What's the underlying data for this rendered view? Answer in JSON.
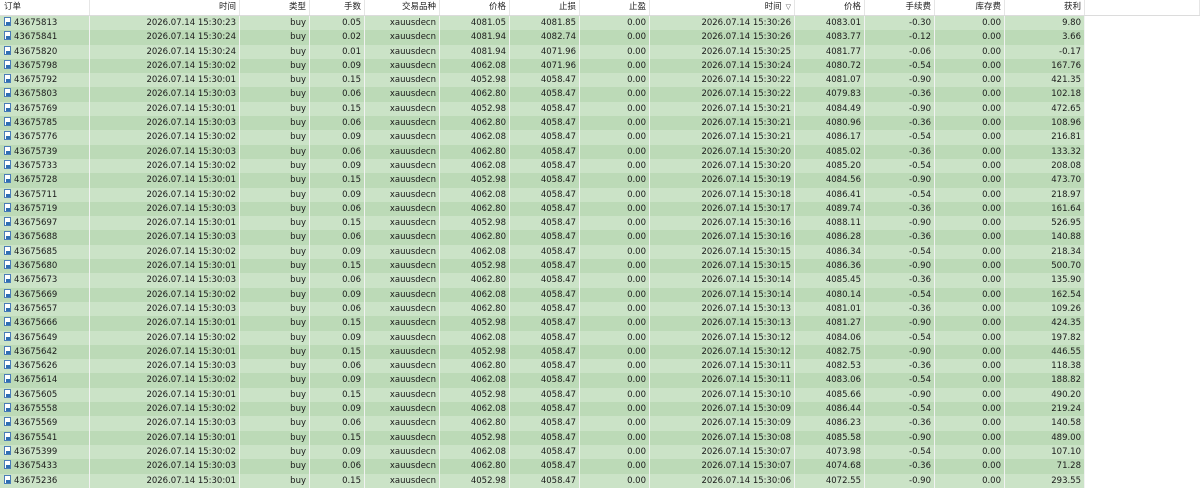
{
  "columns": {
    "order": "订单",
    "open_time": "时间",
    "type": "类型",
    "lots": "手数",
    "symbol": "交易品种",
    "open_price": "价格",
    "sl": "止损",
    "tp": "止盈",
    "close_time": "时间",
    "close_price": "价格",
    "commission": "手续费",
    "swap": "库存费",
    "profit": "获利"
  },
  "sort_indicator": "▽",
  "rows": [
    {
      "order": "43675813",
      "open_time": "2026.07.14 15:30:23",
      "type": "buy",
      "lots": "0.05",
      "symbol": "xauusdecn",
      "open_price": "4081.05",
      "sl": "4081.85",
      "tp": "0.00",
      "close_time": "2026.07.14 15:30:26",
      "close_price": "4083.01",
      "commission": "-0.30",
      "swap": "0.00",
      "profit": "9.80"
    },
    {
      "order": "43675841",
      "open_time": "2026.07.14 15:30:24",
      "type": "buy",
      "lots": "0.02",
      "symbol": "xauusdecn",
      "open_price": "4081.94",
      "sl": "4082.74",
      "tp": "0.00",
      "close_time": "2026.07.14 15:30:26",
      "close_price": "4083.77",
      "commission": "-0.12",
      "swap": "0.00",
      "profit": "3.66"
    },
    {
      "order": "43675820",
      "open_time": "2026.07.14 15:30:24",
      "type": "buy",
      "lots": "0.01",
      "symbol": "xauusdecn",
      "open_price": "4081.94",
      "sl": "4071.96",
      "tp": "0.00",
      "close_time": "2026.07.14 15:30:25",
      "close_price": "4081.77",
      "commission": "-0.06",
      "swap": "0.00",
      "profit": "-0.17"
    },
    {
      "order": "43675798",
      "open_time": "2026.07.14 15:30:02",
      "type": "buy",
      "lots": "0.09",
      "symbol": "xauusdecn",
      "open_price": "4062.08",
      "sl": "4071.96",
      "tp": "0.00",
      "close_time": "2026.07.14 15:30:24",
      "close_price": "4080.72",
      "commission": "-0.54",
      "swap": "0.00",
      "profit": "167.76"
    },
    {
      "order": "43675792",
      "open_time": "2026.07.14 15:30:01",
      "type": "buy",
      "lots": "0.15",
      "symbol": "xauusdecn",
      "open_price": "4052.98",
      "sl": "4058.47",
      "tp": "0.00",
      "close_time": "2026.07.14 15:30:22",
      "close_price": "4081.07",
      "commission": "-0.90",
      "swap": "0.00",
      "profit": "421.35"
    },
    {
      "order": "43675803",
      "open_time": "2026.07.14 15:30:03",
      "type": "buy",
      "lots": "0.06",
      "symbol": "xauusdecn",
      "open_price": "4062.80",
      "sl": "4058.47",
      "tp": "0.00",
      "close_time": "2026.07.14 15:30:22",
      "close_price": "4079.83",
      "commission": "-0.36",
      "swap": "0.00",
      "profit": "102.18"
    },
    {
      "order": "43675769",
      "open_time": "2026.07.14 15:30:01",
      "type": "buy",
      "lots": "0.15",
      "symbol": "xauusdecn",
      "open_price": "4052.98",
      "sl": "4058.47",
      "tp": "0.00",
      "close_time": "2026.07.14 15:30:21",
      "close_price": "4084.49",
      "commission": "-0.90",
      "swap": "0.00",
      "profit": "472.65"
    },
    {
      "order": "43675785",
      "open_time": "2026.07.14 15:30:03",
      "type": "buy",
      "lots": "0.06",
      "symbol": "xauusdecn",
      "open_price": "4062.80",
      "sl": "4058.47",
      "tp": "0.00",
      "close_time": "2026.07.14 15:30:21",
      "close_price": "4080.96",
      "commission": "-0.36",
      "swap": "0.00",
      "profit": "108.96"
    },
    {
      "order": "43675776",
      "open_time": "2026.07.14 15:30:02",
      "type": "buy",
      "lots": "0.09",
      "symbol": "xauusdecn",
      "open_price": "4062.08",
      "sl": "4058.47",
      "tp": "0.00",
      "close_time": "2026.07.14 15:30:21",
      "close_price": "4086.17",
      "commission": "-0.54",
      "swap": "0.00",
      "profit": "216.81"
    },
    {
      "order": "43675739",
      "open_time": "2026.07.14 15:30:03",
      "type": "buy",
      "lots": "0.06",
      "symbol": "xauusdecn",
      "open_price": "4062.80",
      "sl": "4058.47",
      "tp": "0.00",
      "close_time": "2026.07.14 15:30:20",
      "close_price": "4085.02",
      "commission": "-0.36",
      "swap": "0.00",
      "profit": "133.32"
    },
    {
      "order": "43675733",
      "open_time": "2026.07.14 15:30:02",
      "type": "buy",
      "lots": "0.09",
      "symbol": "xauusdecn",
      "open_price": "4062.08",
      "sl": "4058.47",
      "tp": "0.00",
      "close_time": "2026.07.14 15:30:20",
      "close_price": "4085.20",
      "commission": "-0.54",
      "swap": "0.00",
      "profit": "208.08"
    },
    {
      "order": "43675728",
      "open_time": "2026.07.14 15:30:01",
      "type": "buy",
      "lots": "0.15",
      "symbol": "xauusdecn",
      "open_price": "4052.98",
      "sl": "4058.47",
      "tp": "0.00",
      "close_time": "2026.07.14 15:30:19",
      "close_price": "4084.56",
      "commission": "-0.90",
      "swap": "0.00",
      "profit": "473.70"
    },
    {
      "order": "43675711",
      "open_time": "2026.07.14 15:30:02",
      "type": "buy",
      "lots": "0.09",
      "symbol": "xauusdecn",
      "open_price": "4062.08",
      "sl": "4058.47",
      "tp": "0.00",
      "close_time": "2026.07.14 15:30:18",
      "close_price": "4086.41",
      "commission": "-0.54",
      "swap": "0.00",
      "profit": "218.97"
    },
    {
      "order": "43675719",
      "open_time": "2026.07.14 15:30:03",
      "type": "buy",
      "lots": "0.06",
      "symbol": "xauusdecn",
      "open_price": "4062.80",
      "sl": "4058.47",
      "tp": "0.00",
      "close_time": "2026.07.14 15:30:17",
      "close_price": "4089.74",
      "commission": "-0.36",
      "swap": "0.00",
      "profit": "161.64"
    },
    {
      "order": "43675697",
      "open_time": "2026.07.14 15:30:01",
      "type": "buy",
      "lots": "0.15",
      "symbol": "xauusdecn",
      "open_price": "4052.98",
      "sl": "4058.47",
      "tp": "0.00",
      "close_time": "2026.07.14 15:30:16",
      "close_price": "4088.11",
      "commission": "-0.90",
      "swap": "0.00",
      "profit": "526.95"
    },
    {
      "order": "43675688",
      "open_time": "2026.07.14 15:30:03",
      "type": "buy",
      "lots": "0.06",
      "symbol": "xauusdecn",
      "open_price": "4062.80",
      "sl": "4058.47",
      "tp": "0.00",
      "close_time": "2026.07.14 15:30:16",
      "close_price": "4086.28",
      "commission": "-0.36",
      "swap": "0.00",
      "profit": "140.88"
    },
    {
      "order": "43675685",
      "open_time": "2026.07.14 15:30:02",
      "type": "buy",
      "lots": "0.09",
      "symbol": "xauusdecn",
      "open_price": "4062.08",
      "sl": "4058.47",
      "tp": "0.00",
      "close_time": "2026.07.14 15:30:15",
      "close_price": "4086.34",
      "commission": "-0.54",
      "swap": "0.00",
      "profit": "218.34"
    },
    {
      "order": "43675680",
      "open_time": "2026.07.14 15:30:01",
      "type": "buy",
      "lots": "0.15",
      "symbol": "xauusdecn",
      "open_price": "4052.98",
      "sl": "4058.47",
      "tp": "0.00",
      "close_time": "2026.07.14 15:30:15",
      "close_price": "4086.36",
      "commission": "-0.90",
      "swap": "0.00",
      "profit": "500.70"
    },
    {
      "order": "43675673",
      "open_time": "2026.07.14 15:30:03",
      "type": "buy",
      "lots": "0.06",
      "symbol": "xauusdecn",
      "open_price": "4062.80",
      "sl": "4058.47",
      "tp": "0.00",
      "close_time": "2026.07.14 15:30:14",
      "close_price": "4085.45",
      "commission": "-0.36",
      "swap": "0.00",
      "profit": "135.90"
    },
    {
      "order": "43675669",
      "open_time": "2026.07.14 15:30:02",
      "type": "buy",
      "lots": "0.09",
      "symbol": "xauusdecn",
      "open_price": "4062.08",
      "sl": "4058.47",
      "tp": "0.00",
      "close_time": "2026.07.14 15:30:14",
      "close_price": "4080.14",
      "commission": "-0.54",
      "swap": "0.00",
      "profit": "162.54"
    },
    {
      "order": "43675657",
      "open_time": "2026.07.14 15:30:03",
      "type": "buy",
      "lots": "0.06",
      "symbol": "xauusdecn",
      "open_price": "4062.80",
      "sl": "4058.47",
      "tp": "0.00",
      "close_time": "2026.07.14 15:30:13",
      "close_price": "4081.01",
      "commission": "-0.36",
      "swap": "0.00",
      "profit": "109.26"
    },
    {
      "order": "43675666",
      "open_time": "2026.07.14 15:30:01",
      "type": "buy",
      "lots": "0.15",
      "symbol": "xauusdecn",
      "open_price": "4052.98",
      "sl": "4058.47",
      "tp": "0.00",
      "close_time": "2026.07.14 15:30:13",
      "close_price": "4081.27",
      "commission": "-0.90",
      "swap": "0.00",
      "profit": "424.35"
    },
    {
      "order": "43675649",
      "open_time": "2026.07.14 15:30:02",
      "type": "buy",
      "lots": "0.09",
      "symbol": "xauusdecn",
      "open_price": "4062.08",
      "sl": "4058.47",
      "tp": "0.00",
      "close_time": "2026.07.14 15:30:12",
      "close_price": "4084.06",
      "commission": "-0.54",
      "swap": "0.00",
      "profit": "197.82"
    },
    {
      "order": "43675642",
      "open_time": "2026.07.14 15:30:01",
      "type": "buy",
      "lots": "0.15",
      "symbol": "xauusdecn",
      "open_price": "4052.98",
      "sl": "4058.47",
      "tp": "0.00",
      "close_time": "2026.07.14 15:30:12",
      "close_price": "4082.75",
      "commission": "-0.90",
      "swap": "0.00",
      "profit": "446.55"
    },
    {
      "order": "43675626",
      "open_time": "2026.07.14 15:30:03",
      "type": "buy",
      "lots": "0.06",
      "symbol": "xauusdecn",
      "open_price": "4062.80",
      "sl": "4058.47",
      "tp": "0.00",
      "close_time": "2026.07.14 15:30:11",
      "close_price": "4082.53",
      "commission": "-0.36",
      "swap": "0.00",
      "profit": "118.38"
    },
    {
      "order": "43675614",
      "open_time": "2026.07.14 15:30:02",
      "type": "buy",
      "lots": "0.09",
      "symbol": "xauusdecn",
      "open_price": "4062.08",
      "sl": "4058.47",
      "tp": "0.00",
      "close_time": "2026.07.14 15:30:11",
      "close_price": "4083.06",
      "commission": "-0.54",
      "swap": "0.00",
      "profit": "188.82"
    },
    {
      "order": "43675605",
      "open_time": "2026.07.14 15:30:01",
      "type": "buy",
      "lots": "0.15",
      "symbol": "xauusdecn",
      "open_price": "4052.98",
      "sl": "4058.47",
      "tp": "0.00",
      "close_time": "2026.07.14 15:30:10",
      "close_price": "4085.66",
      "commission": "-0.90",
      "swap": "0.00",
      "profit": "490.20"
    },
    {
      "order": "43675558",
      "open_time": "2026.07.14 15:30:02",
      "type": "buy",
      "lots": "0.09",
      "symbol": "xauusdecn",
      "open_price": "4062.08",
      "sl": "4058.47",
      "tp": "0.00",
      "close_time": "2026.07.14 15:30:09",
      "close_price": "4086.44",
      "commission": "-0.54",
      "swap": "0.00",
      "profit": "219.24"
    },
    {
      "order": "43675569",
      "open_time": "2026.07.14 15:30:03",
      "type": "buy",
      "lots": "0.06",
      "symbol": "xauusdecn",
      "open_price": "4062.80",
      "sl": "4058.47",
      "tp": "0.00",
      "close_time": "2026.07.14 15:30:09",
      "close_price": "4086.23",
      "commission": "-0.36",
      "swap": "0.00",
      "profit": "140.58"
    },
    {
      "order": "43675541",
      "open_time": "2026.07.14 15:30:01",
      "type": "buy",
      "lots": "0.15",
      "symbol": "xauusdecn",
      "open_price": "4052.98",
      "sl": "4058.47",
      "tp": "0.00",
      "close_time": "2026.07.14 15:30:08",
      "close_price": "4085.58",
      "commission": "-0.90",
      "swap": "0.00",
      "profit": "489.00"
    },
    {
      "order": "43675399",
      "open_time": "2026.07.14 15:30:02",
      "type": "buy",
      "lots": "0.09",
      "symbol": "xauusdecn",
      "open_price": "4062.08",
      "sl": "4058.47",
      "tp": "0.00",
      "close_time": "2026.07.14 15:30:07",
      "close_price": "4073.98",
      "commission": "-0.54",
      "swap": "0.00",
      "profit": "107.10"
    },
    {
      "order": "43675433",
      "open_time": "2026.07.14 15:30:03",
      "type": "buy",
      "lots": "0.06",
      "symbol": "xauusdecn",
      "open_price": "4062.80",
      "sl": "4058.47",
      "tp": "0.00",
      "close_time": "2026.07.14 15:30:07",
      "close_price": "4074.68",
      "commission": "-0.36",
      "swap": "0.00",
      "profit": "71.28"
    },
    {
      "order": "43675236",
      "open_time": "2026.07.14 15:30:01",
      "type": "buy",
      "lots": "0.15",
      "symbol": "xauusdecn",
      "open_price": "4052.98",
      "sl": "4058.47",
      "tp": "0.00",
      "close_time": "2026.07.14 15:30:06",
      "close_price": "4072.55",
      "commission": "-0.90",
      "swap": "0.00",
      "profit": "293.55"
    }
  ]
}
